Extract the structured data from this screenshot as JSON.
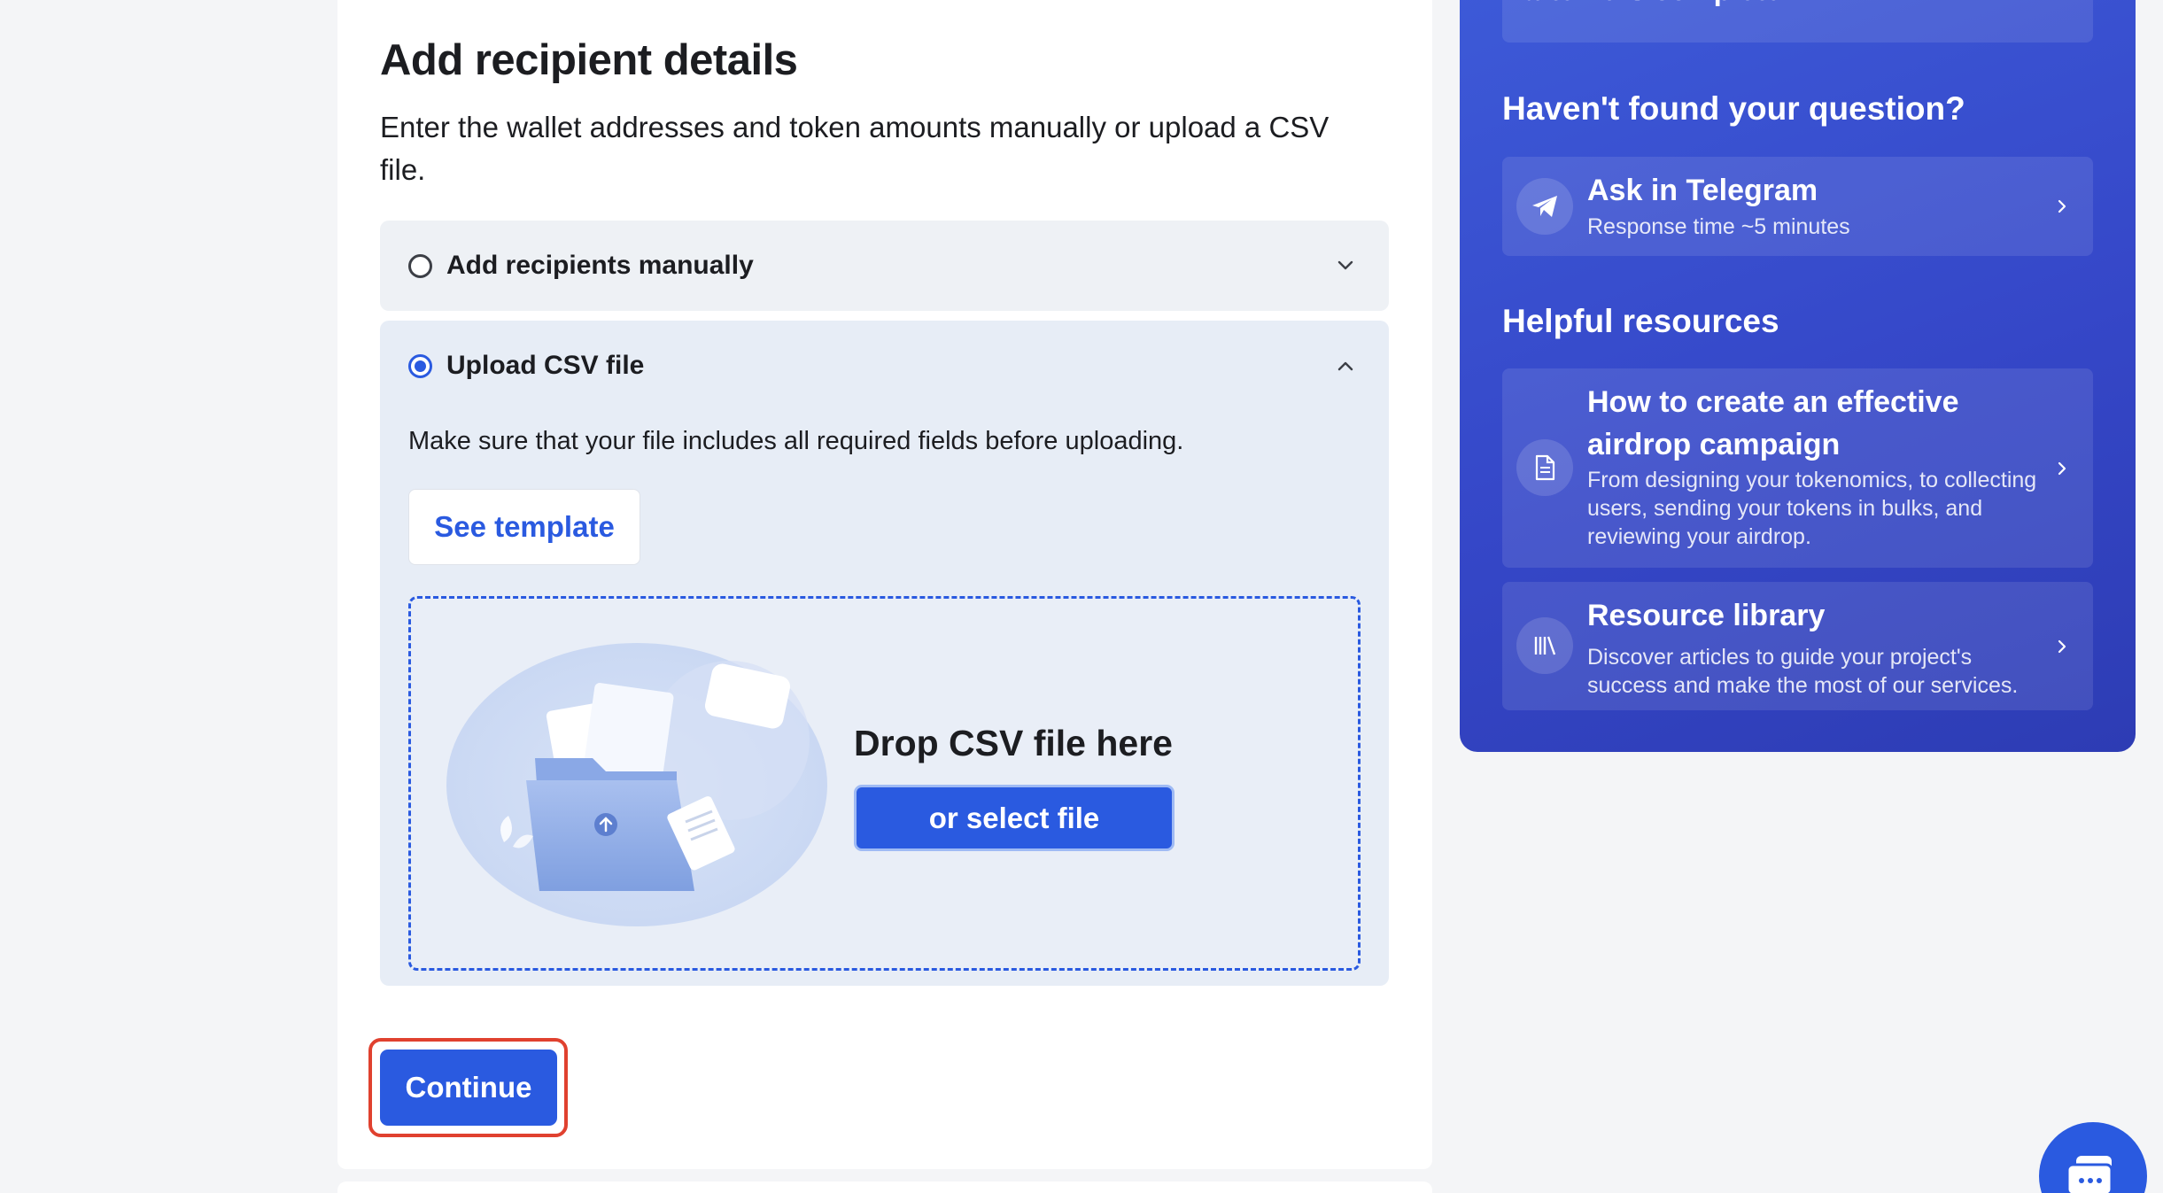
{
  "main": {
    "title": "Add recipient details",
    "subtitle": "Enter the wallet addresses and token amounts manually or upload a CSV file.",
    "options": [
      {
        "label": "Add recipients manually",
        "selected": false,
        "expanded": false
      },
      {
        "label": "Upload CSV file",
        "selected": true,
        "expanded": true
      }
    ],
    "csv": {
      "note": "Make sure that your file includes all required fields before uploading.",
      "see_template_label": "See template",
      "drop_title": "Drop CSV file here",
      "select_file_label": "or select file"
    },
    "continue_label": "Continue"
  },
  "sidebar": {
    "faq_fragment": "after it is complete?",
    "question_heading": "Haven't found your question?",
    "telegram": {
      "title": "Ask in Telegram",
      "desc": "Response time ~5 minutes",
      "icon": "paper-plane-icon"
    },
    "resources_heading": "Helpful resources",
    "resources": [
      {
        "title": "How to create an effective airdrop campaign",
        "desc": "From designing your tokenomics, to collecting users, sending your tokens in bulks, and reviewing your airdrop.",
        "icon": "document-icon"
      },
      {
        "title": "Resource library",
        "desc": "Discover articles to guide your project's success and make the most of our services.",
        "icon": "library-icon"
      }
    ]
  },
  "colors": {
    "accent": "#2a5ae0",
    "highlight_outline": "#e0412f",
    "sidebar_gradient_start": "#3d5ad8",
    "sidebar_gradient_end": "#2d3cb4"
  },
  "chat": {
    "icon": "chat-bubble-icon"
  }
}
